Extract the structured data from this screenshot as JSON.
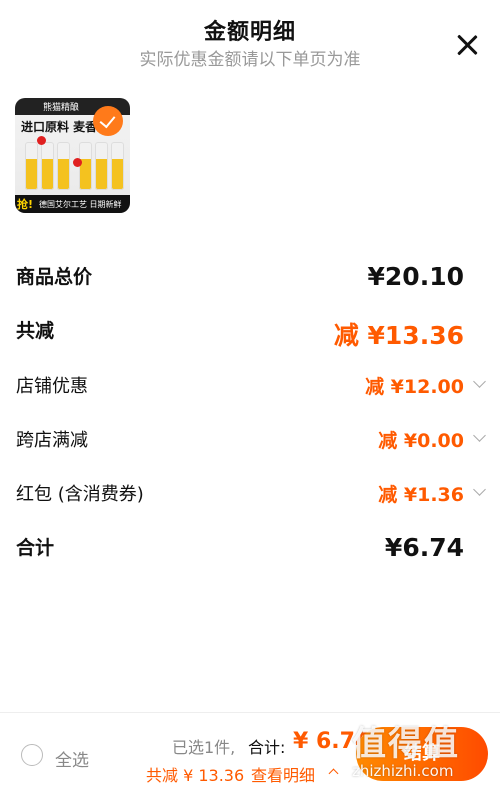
{
  "header": {
    "title": "金额明细",
    "subtitle": "实际优惠金额请以下单页为准"
  },
  "product": {
    "brand": "熊猫精酿",
    "headline": "进口原料 麦香浓",
    "badge": "抢!",
    "strip_text": "德国艾尔工艺 日期新鲜"
  },
  "rows": [
    {
      "label": "商品总价",
      "value": "¥20.10",
      "style": "bold",
      "color": "#111111",
      "has_chevron": false
    },
    {
      "label": "共减",
      "value": "减 ¥13.36",
      "style": "bold",
      "color": "#ff5a00",
      "has_chevron": false
    },
    {
      "label": "店铺优惠",
      "value": "减 ¥12.00",
      "style": "normal",
      "color": "#ff5a00",
      "has_chevron": true
    },
    {
      "label": "跨店满减",
      "value": "减 ¥0.00",
      "style": "normal",
      "color": "#ff5a00",
      "has_chevron": true
    },
    {
      "label": "红包 (含消费券)",
      "value": "减 ¥1.36",
      "style": "normal",
      "color": "#ff5a00",
      "has_chevron": true
    },
    {
      "label": "合计",
      "value": "¥6.74",
      "style": "bold",
      "color": "#111111",
      "has_chevron": false
    }
  ],
  "footer": {
    "select_all": "全选",
    "selected_count": "已选1件,",
    "total_label": "合计:",
    "total_value": "¥ 6.74",
    "savings": "共减 ¥ 13.36",
    "view_detail": "查看明细",
    "checkout": "结算",
    "watermark": "值得值",
    "watermark_url": "zhizhizhi.com"
  },
  "colors": {
    "accent": "#ff5a00",
    "text": "#111111",
    "muted": "#999999"
  }
}
